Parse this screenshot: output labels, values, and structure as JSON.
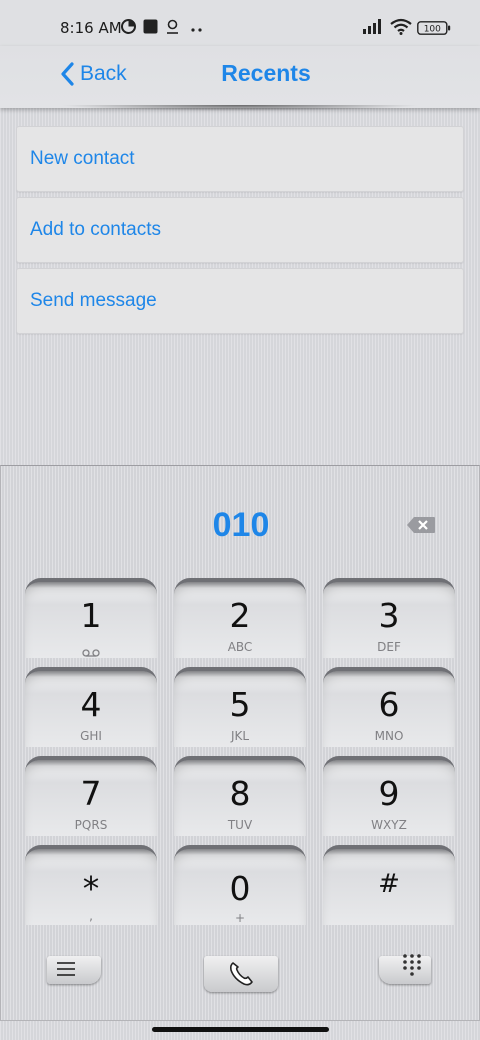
{
  "status": {
    "time": "8:16 AM",
    "battery": "100",
    "icons": [
      "pie-icon",
      "square-icon",
      "location-icon",
      "more-dots-icon",
      "signal-icon",
      "wifi-icon",
      "battery-icon"
    ]
  },
  "nav": {
    "back_label": "Back",
    "title": "Recents"
  },
  "actions": [
    "New contact",
    "Add to contacts",
    "Send message"
  ],
  "dialer": {
    "number": "010",
    "keys": [
      {
        "digit": "1",
        "letters": ""
      },
      {
        "digit": "2",
        "letters": "ABC"
      },
      {
        "digit": "3",
        "letters": "DEF"
      },
      {
        "digit": "4",
        "letters": "GHI"
      },
      {
        "digit": "5",
        "letters": "JKL"
      },
      {
        "digit": "6",
        "letters": "MNO"
      },
      {
        "digit": "7",
        "letters": "PQRS"
      },
      {
        "digit": "8",
        "letters": "TUV"
      },
      {
        "digit": "9",
        "letters": "WXYZ"
      },
      {
        "digit": "*",
        "letters": ","
      },
      {
        "digit": "0",
        "letters": "+"
      },
      {
        "digit": "#",
        "letters": ""
      }
    ]
  },
  "colors": {
    "accent": "#1e86e8",
    "background": "#dadbdf"
  }
}
